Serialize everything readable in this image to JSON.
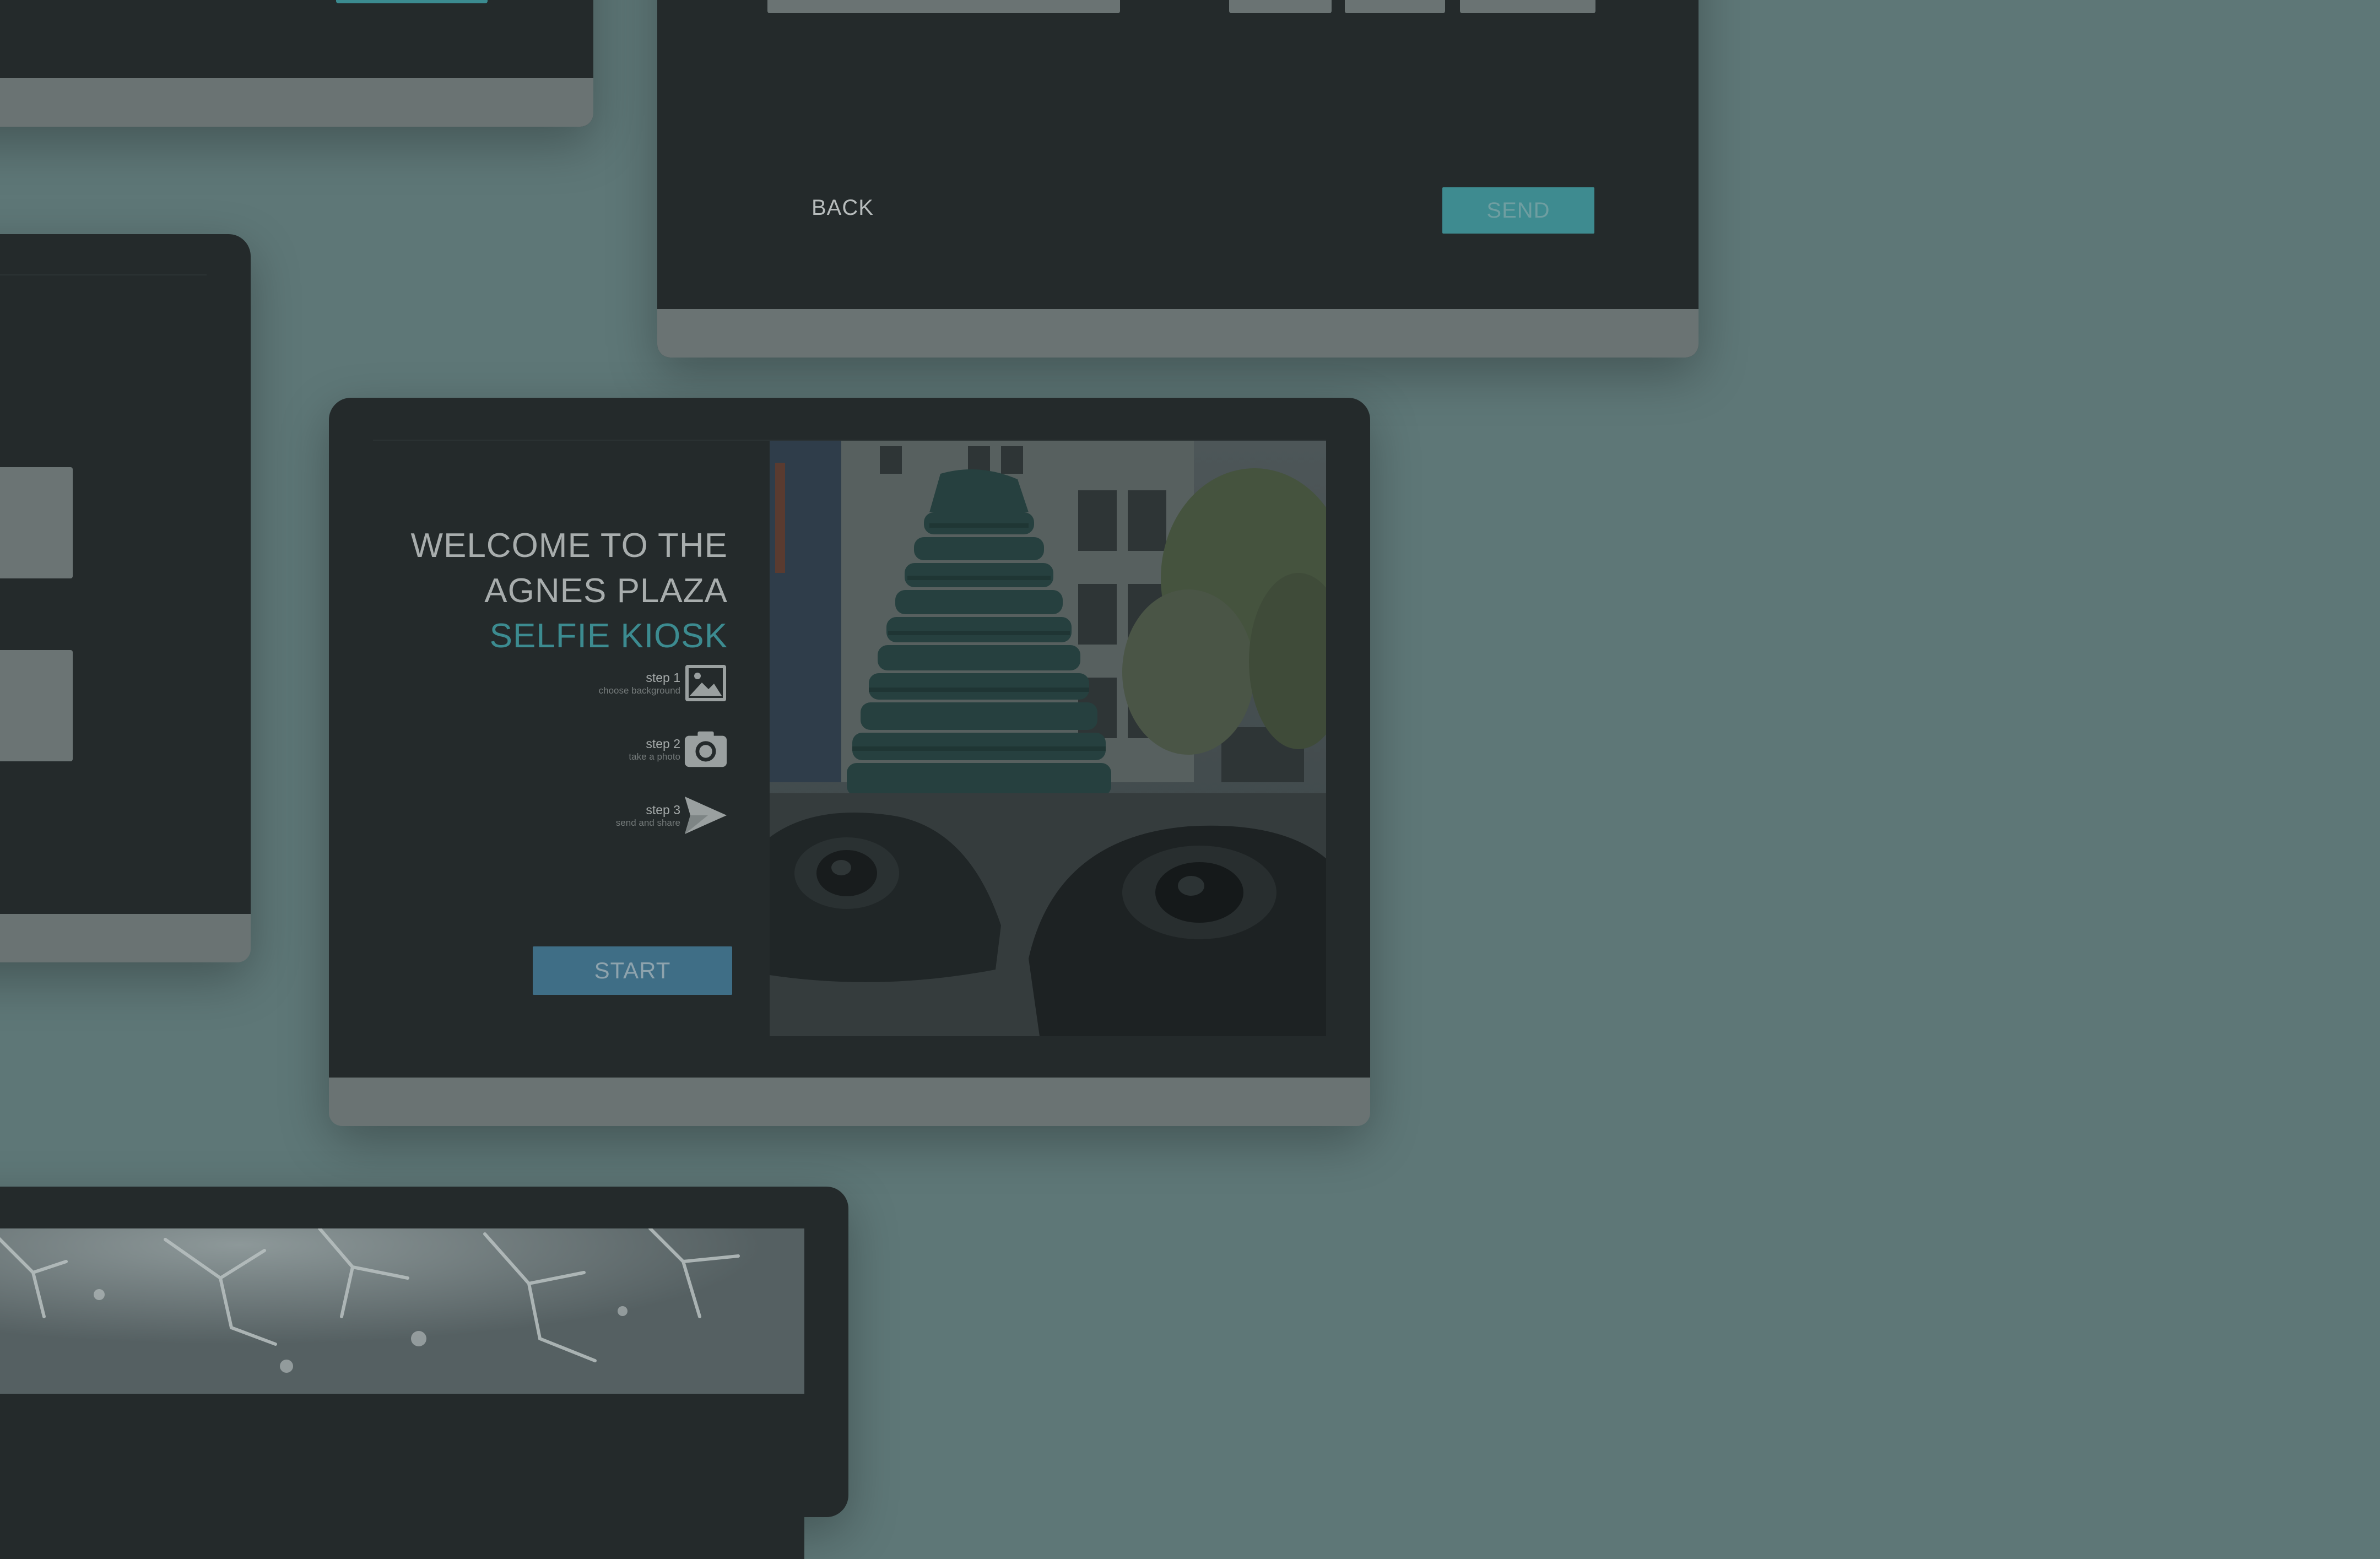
{
  "send_screen": {
    "back_label": "BACK",
    "send_label": "SEND"
  },
  "welcome_screen": {
    "title_line1": "WELCOME TO THE",
    "title_line2": "AGNES PLAZA",
    "title_line3": "SELFIE KIOSK",
    "steps": [
      {
        "label": "step 1",
        "sub": "choose background",
        "icon": "image-icon"
      },
      {
        "label": "step 2",
        "sub": "take a photo",
        "icon": "camera-icon"
      },
      {
        "label": "step 3",
        "sub": "send and share",
        "icon": "send-icon"
      }
    ],
    "start_label": "START"
  },
  "colors": {
    "background": "#5e7777",
    "device": "#242a2b",
    "chin": "#6a7373",
    "accent_teal": "#3c8b90",
    "start_blue": "#3f6e86"
  }
}
